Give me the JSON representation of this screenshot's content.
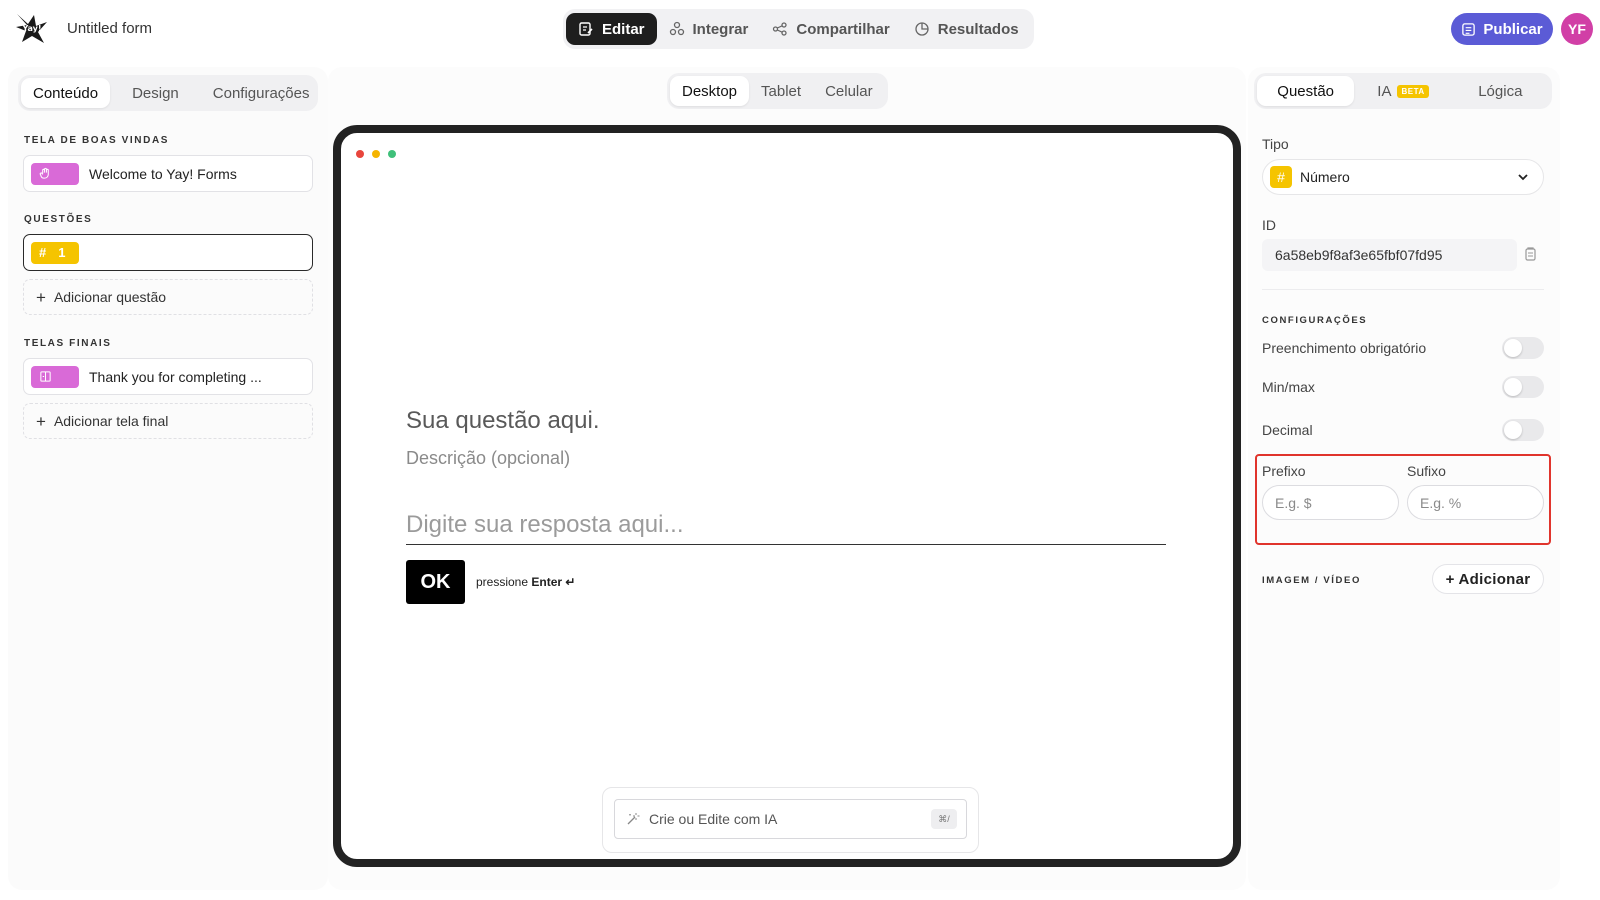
{
  "header": {
    "form_title": "Untitled form",
    "logo_text": "Yay!",
    "nav": [
      {
        "label": "Editar",
        "icon": "edit-icon",
        "active": true
      },
      {
        "label": "Integrar",
        "icon": "integrate-icon",
        "active": false
      },
      {
        "label": "Compartilhar",
        "icon": "share-icon",
        "active": false
      },
      {
        "label": "Resultados",
        "icon": "results-icon",
        "active": false
      }
    ],
    "publish_label": "Publicar",
    "avatar_initials": "YF"
  },
  "left": {
    "tabs": [
      "Conteúdo",
      "Design",
      "Configurações"
    ],
    "active_tab": "Conteúdo",
    "welcome_section": "TELA DE BOAS VINDAS",
    "welcome_item": "Welcome to Yay! Forms",
    "questions_section": "QUESTÕES",
    "question_number": "1",
    "add_question": "Adicionar questão",
    "endings_section": "TELAS FINAIS",
    "ending_item": "Thank you for completing ...",
    "add_ending": "Adicionar tela final"
  },
  "center": {
    "device_tabs": [
      "Desktop",
      "Tablet",
      "Celular"
    ],
    "active_device": "Desktop",
    "question_title": "Sua questão aqui.",
    "question_description": "Descrição (opcional)",
    "answer_placeholder": "Digite sua resposta aqui...",
    "ok_label": "OK",
    "enter_hint_prefix": "pressione",
    "enter_hint_key": "Enter ↵",
    "ai_placeholder": "Crie ou Edite com IA",
    "ai_shortcut": "⌘/"
  },
  "right": {
    "tabs": [
      "Questão",
      "IA",
      "Lógica"
    ],
    "beta_label": "BETA",
    "type_label": "Tipo",
    "type_value": "Número",
    "id_label": "ID",
    "id_value": "6a58eb9f8af3e65fbf07fd95",
    "settings_section": "CONFIGURAÇÕES",
    "required_label": "Preenchimento obrigatório",
    "minmax_label": "Min/max",
    "decimal_label": "Decimal",
    "prefix_label": "Prefixo",
    "prefix_placeholder": "E.g. $",
    "suffix_label": "Sufixo",
    "suffix_placeholder": "E.g. %",
    "media_section": "IMAGEM / VÍDEO",
    "add_media": "+ Adicionar"
  },
  "colors": {
    "accent": "#5b5bd6",
    "avatar": "#d13fa6",
    "number_badge": "#f5c400",
    "screen_badge": "#d96ad7",
    "highlight": "#e0342c",
    "dot_red": "#e8453c",
    "dot_yellow": "#f5b400",
    "dot_green": "#3fc07a"
  }
}
